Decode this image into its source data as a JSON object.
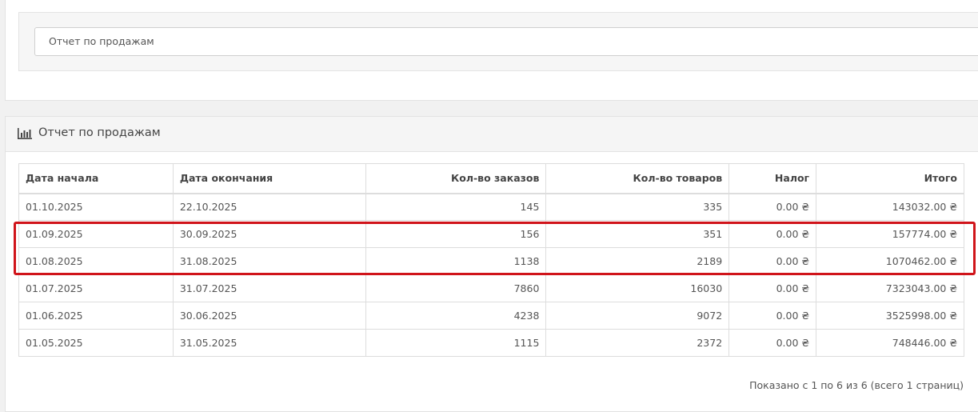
{
  "filter": {
    "report_select": "Отчет по продажам"
  },
  "panel": {
    "title": "Отчет по продажам",
    "icon": "bar-chart-icon"
  },
  "table": {
    "headers": [
      "Дата начала",
      "Дата окончания",
      "Кол-во заказов",
      "Кол-во товаров",
      "Налог",
      "Итого"
    ],
    "rows": [
      [
        "01.10.2025",
        "22.10.2025",
        "145",
        "335",
        "0.00 ₴",
        "143032.00 ₴"
      ],
      [
        "01.09.2025",
        "30.09.2025",
        "156",
        "351",
        "0.00 ₴",
        "157774.00 ₴"
      ],
      [
        "01.08.2025",
        "31.08.2025",
        "1138",
        "2189",
        "0.00 ₴",
        "1070462.00 ₴"
      ],
      [
        "01.07.2025",
        "31.07.2025",
        "7860",
        "16030",
        "0.00 ₴",
        "7323043.00 ₴"
      ],
      [
        "01.06.2025",
        "30.06.2025",
        "4238",
        "9072",
        "0.00 ₴",
        "3525998.00 ₴"
      ],
      [
        "01.05.2025",
        "31.05.2025",
        "1115",
        "2372",
        "0.00 ₴",
        "748446.00 ₴"
      ]
    ]
  },
  "highlight_color": "#d0141a",
  "pagination": {
    "text": "Показано с 1 по 6 из 6 (всего 1 страниц)"
  }
}
